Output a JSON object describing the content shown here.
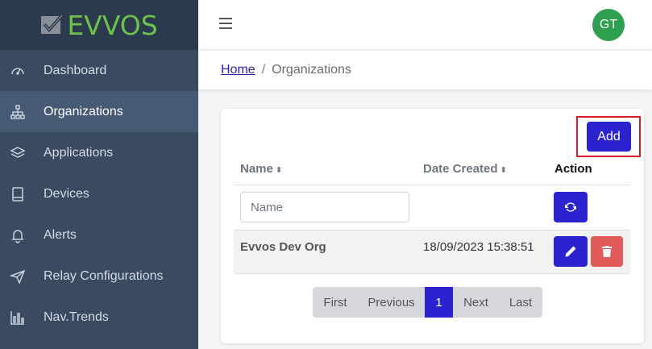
{
  "brand": {
    "name": "EVVOS",
    "accent": "#6cc24a"
  },
  "sidebar": {
    "items": [
      {
        "label": "Dashboard",
        "icon": "gauge-icon",
        "active": false
      },
      {
        "label": "Organizations",
        "icon": "sitemap-icon",
        "active": true
      },
      {
        "label": "Applications",
        "icon": "layers-icon",
        "active": false
      },
      {
        "label": "Devices",
        "icon": "tablet-icon",
        "active": false
      },
      {
        "label": "Alerts",
        "icon": "bell-icon",
        "active": false
      },
      {
        "label": "Relay Configurations",
        "icon": "send-icon",
        "active": false
      },
      {
        "label": "Nav.Trends",
        "icon": "bar-chart-icon",
        "active": false
      }
    ]
  },
  "header": {
    "avatar_initials": "GT",
    "avatar_color": "#2e9e4f"
  },
  "breadcrumb": {
    "home": "Home",
    "separator": "/",
    "current": "Organizations"
  },
  "toolbar": {
    "add_label": "Add"
  },
  "table": {
    "columns": {
      "name": "Name",
      "date_created": "Date Created",
      "action": "Action"
    },
    "sort_glyph": "⬍",
    "filter": {
      "name_placeholder": "Name"
    },
    "rows": [
      {
        "name": "Evvos Dev Org",
        "date_created": "18/09/2023 15:38:51"
      }
    ]
  },
  "pagination": {
    "first": "First",
    "previous": "Previous",
    "current_page": "1",
    "next": "Next",
    "last": "Last"
  },
  "colors": {
    "primary": "#2c23d0",
    "danger": "#e25b5b",
    "highlight": "#d81b2a",
    "sidebar": "#3a4a60"
  }
}
